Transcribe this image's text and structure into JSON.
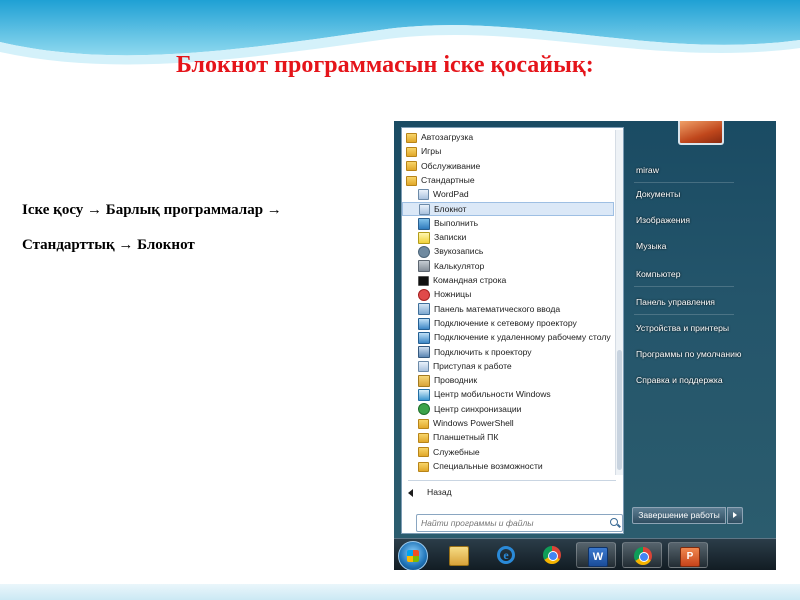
{
  "slide": {
    "title": "Блокнот программасын іске қосайық:",
    "instruction_line1": "Іске қосу → Барлық программалар →",
    "instruction_line2": "Стандарттық → Блокнот"
  },
  "start_menu": {
    "programs": [
      {
        "label": "Автозагрузка",
        "icon": "folder-icon",
        "level": 0
      },
      {
        "label": "Игры",
        "icon": "folder-icon",
        "level": 0
      },
      {
        "label": "Обслуживание",
        "icon": "folder-icon",
        "level": 0
      },
      {
        "label": "Стандартные",
        "icon": "folder-icon",
        "level": 0
      },
      {
        "label": "WordPad",
        "icon": "wordpad-icon",
        "level": 1
      },
      {
        "label": "Блокнот",
        "icon": "notepad-icon",
        "level": 1,
        "selected": true
      },
      {
        "label": "Выполнить",
        "icon": "run-icon",
        "level": 1
      },
      {
        "label": "Записки",
        "icon": "sticky-notes-icon",
        "level": 1
      },
      {
        "label": "Звукозапись",
        "icon": "microphone-icon",
        "level": 1
      },
      {
        "label": "Калькулятор",
        "icon": "calculator-icon",
        "level": 1
      },
      {
        "label": "Командная строка",
        "icon": "command-prompt-icon",
        "level": 1
      },
      {
        "label": "Ножницы",
        "icon": "scissors-icon",
        "level": 1
      },
      {
        "label": "Панель математического ввода",
        "icon": "math-input-icon",
        "level": 1
      },
      {
        "label": "Подключение к сетевому проектору",
        "icon": "network-projector-icon",
        "level": 1
      },
      {
        "label": "Подключение к удаленному рабочему столу",
        "icon": "remote-desktop-icon",
        "level": 1
      },
      {
        "label": "Подключить к проектору",
        "icon": "projector-icon",
        "level": 1
      },
      {
        "label": "Приступая к работе",
        "icon": "getting-started-icon",
        "level": 1
      },
      {
        "label": "Проводник",
        "icon": "explorer-icon",
        "level": 1
      },
      {
        "label": "Центр мобильности Windows",
        "icon": "mobility-center-icon",
        "level": 1
      },
      {
        "label": "Центр синхронизации",
        "icon": "sync-center-icon",
        "level": 1
      },
      {
        "label": "Windows PowerShell",
        "icon": "folder-icon",
        "level": 1
      },
      {
        "label": "Планшетный ПК",
        "icon": "folder-icon",
        "level": 1
      },
      {
        "label": "Служебные",
        "icon": "folder-icon",
        "level": 1
      },
      {
        "label": "Специальные возможности",
        "icon": "folder-icon",
        "level": 1
      }
    ],
    "back_label": "Назад",
    "search_placeholder": "Найти программы и файлы",
    "right_pane": [
      {
        "label": "miraw",
        "name": "user-name"
      },
      {
        "label": "Документы",
        "name": "documents"
      },
      {
        "label": "Изображения",
        "name": "pictures"
      },
      {
        "label": "Музыка",
        "name": "music"
      },
      {
        "label": "Компьютер",
        "name": "computer"
      },
      {
        "label": "Панель управления",
        "name": "control-panel"
      },
      {
        "label": "Устройства и принтеры",
        "name": "devices-printers"
      },
      {
        "label": "Программы по умолчанию",
        "name": "default-programs"
      },
      {
        "label": "Справка и поддержка",
        "name": "help-support"
      }
    ],
    "shutdown_label": "Завершение работы"
  },
  "taskbar": {
    "word_letter": "W",
    "ie_letter": "e",
    "ppt_letter": "P"
  },
  "colors": {
    "title_red": "#e5141a",
    "header_blue": "#5ec8e8",
    "selection": "#dbe8f7"
  }
}
